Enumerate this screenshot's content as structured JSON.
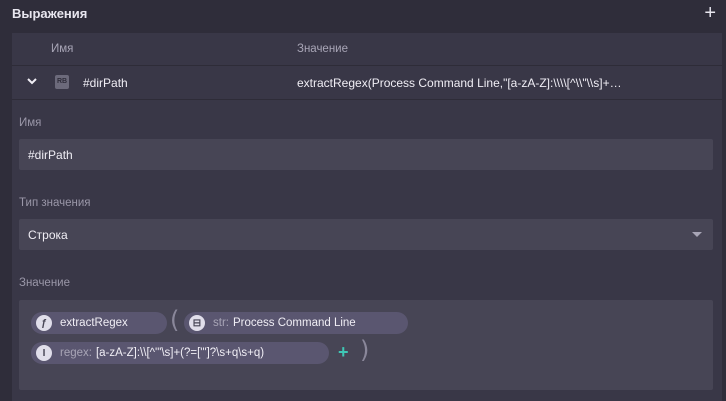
{
  "header": {
    "title": "Выражения",
    "add_icon": "plus-icon"
  },
  "table": {
    "col_name": "Имя",
    "col_value": "Значение",
    "row": {
      "badge": "RB",
      "name": "#dirPath",
      "value": "extractRegex(Process Command Line,\"[a-zA-Z]:\\\\\\\\[^\\\\\"\\\\s]+…"
    }
  },
  "form": {
    "name_label": "Имя",
    "name_value": "#dirPath",
    "type_label": "Тип значения",
    "type_value": "Строка",
    "value_label": "Значение",
    "func_name": "extractRegex",
    "str_key": "str:",
    "str_value": "Process Command Line",
    "regex_key": "regex:",
    "regex_value": "[a-zA-Z]:\\\\[^'\"\\s]+(?=['\"]?\\s+q\\s+q)",
    "open_paren": "(",
    "close_paren": ")",
    "add_arg": "+"
  },
  "colors": {
    "accent": "#3fc7b5",
    "background": "#2f2d3a",
    "panel": "#393747",
    "field": "#474555"
  }
}
